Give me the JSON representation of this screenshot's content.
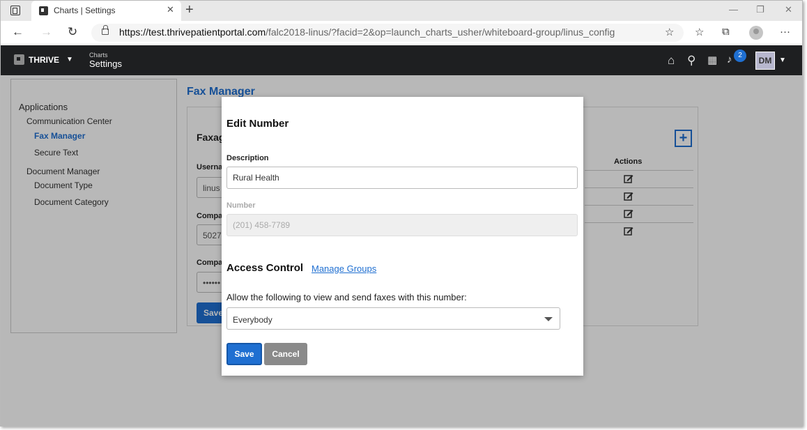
{
  "browser": {
    "tab_title": "Charts | Settings",
    "url_host": "https://test.thrivepatientportal.com",
    "url_path": "/falc2018-linus/?facid=2&op=launch_charts_usher/whiteboard-group/linus_config"
  },
  "app": {
    "brand": "THRIVE",
    "context_small": "Charts",
    "context_big": "Settings",
    "notification_count": "2",
    "user_initials": "DM"
  },
  "sidebar": {
    "items": [
      {
        "label": "Applications"
      },
      {
        "label": "Communication Center"
      },
      {
        "label": "Fax Manager"
      },
      {
        "label": "Secure Text"
      },
      {
        "label": "Document Manager"
      },
      {
        "label": "Document Type"
      },
      {
        "label": "Document Category"
      }
    ]
  },
  "content": {
    "title": "Fax Manager",
    "panel_heading_partial": "Faxag",
    "field1_label_partial": "Userna",
    "field1_value_partial": "linus",
    "field2_label_partial": "Compa",
    "field2_value_partial": "5027",
    "field3_label_partial": "Compa",
    "field3_value_partial": "••••••",
    "save_partial": "Save",
    "add_symbol": "+",
    "actions_header": "Actions"
  },
  "modal": {
    "title": "Edit Number",
    "description_label": "Description",
    "description_value": "Rural Health",
    "number_label": "Number",
    "number_value": "(201) 458-7789",
    "access_control_title": "Access Control",
    "manage_groups_link": "Manage Groups",
    "allow_text": "Allow the following to view and send faxes with this number:",
    "access_selected": "Everybody",
    "save_label": "Save",
    "cancel_label": "Cancel"
  }
}
